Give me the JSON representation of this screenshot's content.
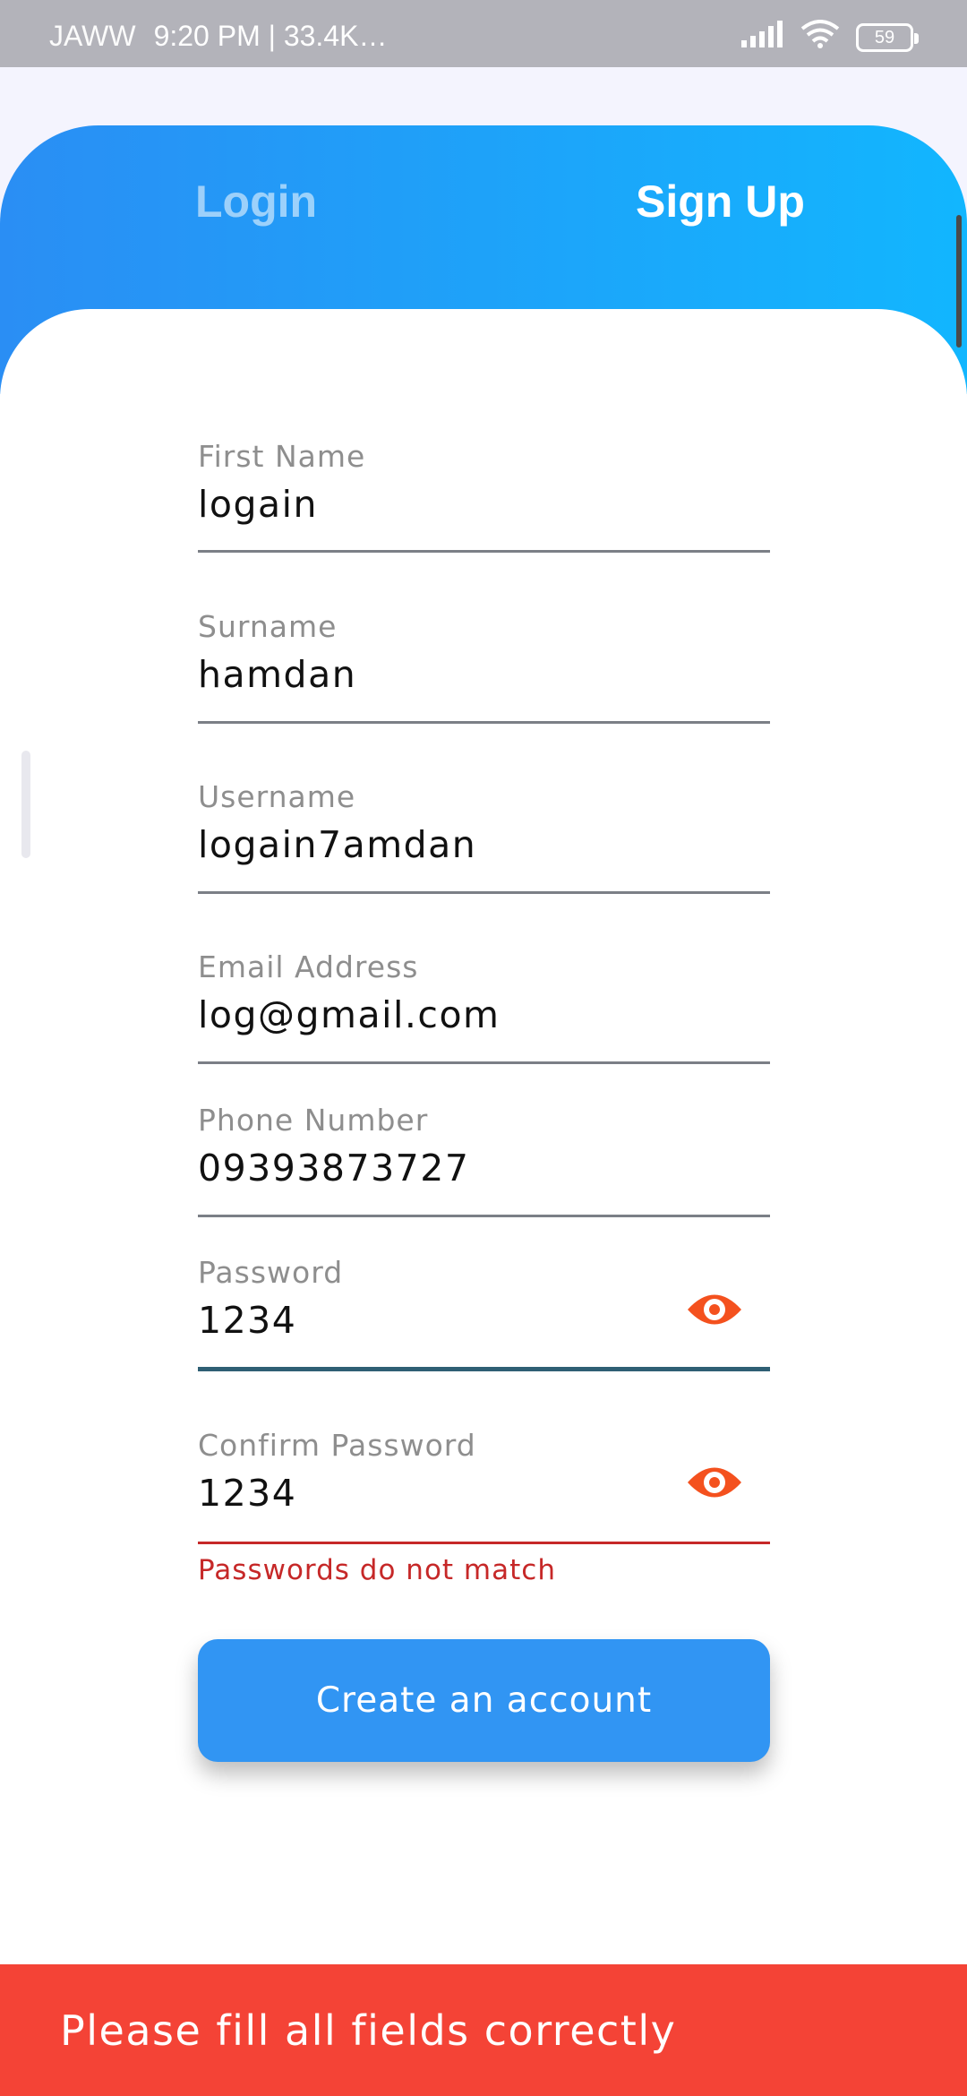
{
  "status_bar": {
    "carrier": "JAWW",
    "info": "9:20 PM | 33.4K…",
    "battery": "59",
    "signal_icon": "signal-icon",
    "wifi_icon": "wifi-icon"
  },
  "tabs": {
    "login": "Login",
    "signup": "Sign Up"
  },
  "form": {
    "first_name": {
      "label": "First Name",
      "value": "logain"
    },
    "surname": {
      "label": "Surname",
      "value": "hamdan"
    },
    "username": {
      "label": "Username",
      "value": "logain7amdan"
    },
    "email": {
      "label": "Email Address",
      "value": "log@gmail.com"
    },
    "phone": {
      "label": "Phone Number",
      "value": "09393873727"
    },
    "password": {
      "label": "Password",
      "value": "1234"
    },
    "confirm_password": {
      "label": "Confirm Password",
      "value": "1234"
    },
    "error_message": "Passwords do not match",
    "submit_label": "Create an account"
  },
  "snackbar": {
    "message": "Please fill all fields correctly"
  },
  "colors": {
    "gradient_start": "#2a8ef4",
    "gradient_end": "#12b6fe",
    "accent_orange": "#f4511e",
    "error_red": "#c62828",
    "button_blue": "#3195f3",
    "snackbar_red": "#f44336"
  }
}
